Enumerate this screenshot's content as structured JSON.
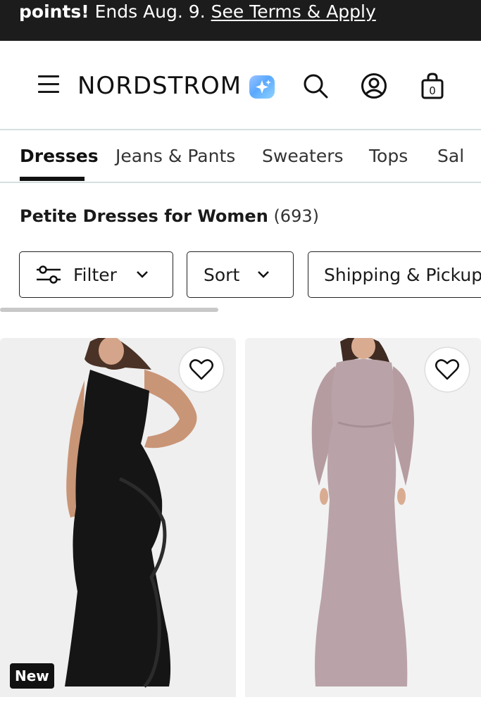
{
  "promo": {
    "bold": "points!",
    "text": " Ends Aug. 9. ",
    "link": "See Terms & Apply"
  },
  "header": {
    "logo": "NORDSTROM",
    "icons": [
      "menu-icon",
      "sparkle-icon",
      "search-icon",
      "account-icon",
      "bag-icon"
    ],
    "bag_count": "0"
  },
  "tabs": [
    "Dresses",
    "Jeans & Pants",
    "Sweaters",
    "Tops",
    "Sal"
  ],
  "page": {
    "title": "Petite Dresses for Women",
    "count": "(693)"
  },
  "filters": {
    "filter": "Filter",
    "sort": "Sort",
    "shipping": "Shipping & Pickup"
  },
  "products": [
    {
      "badge": "New",
      "color": "#151515"
    },
    {
      "color": "#b9a3a8"
    }
  ]
}
